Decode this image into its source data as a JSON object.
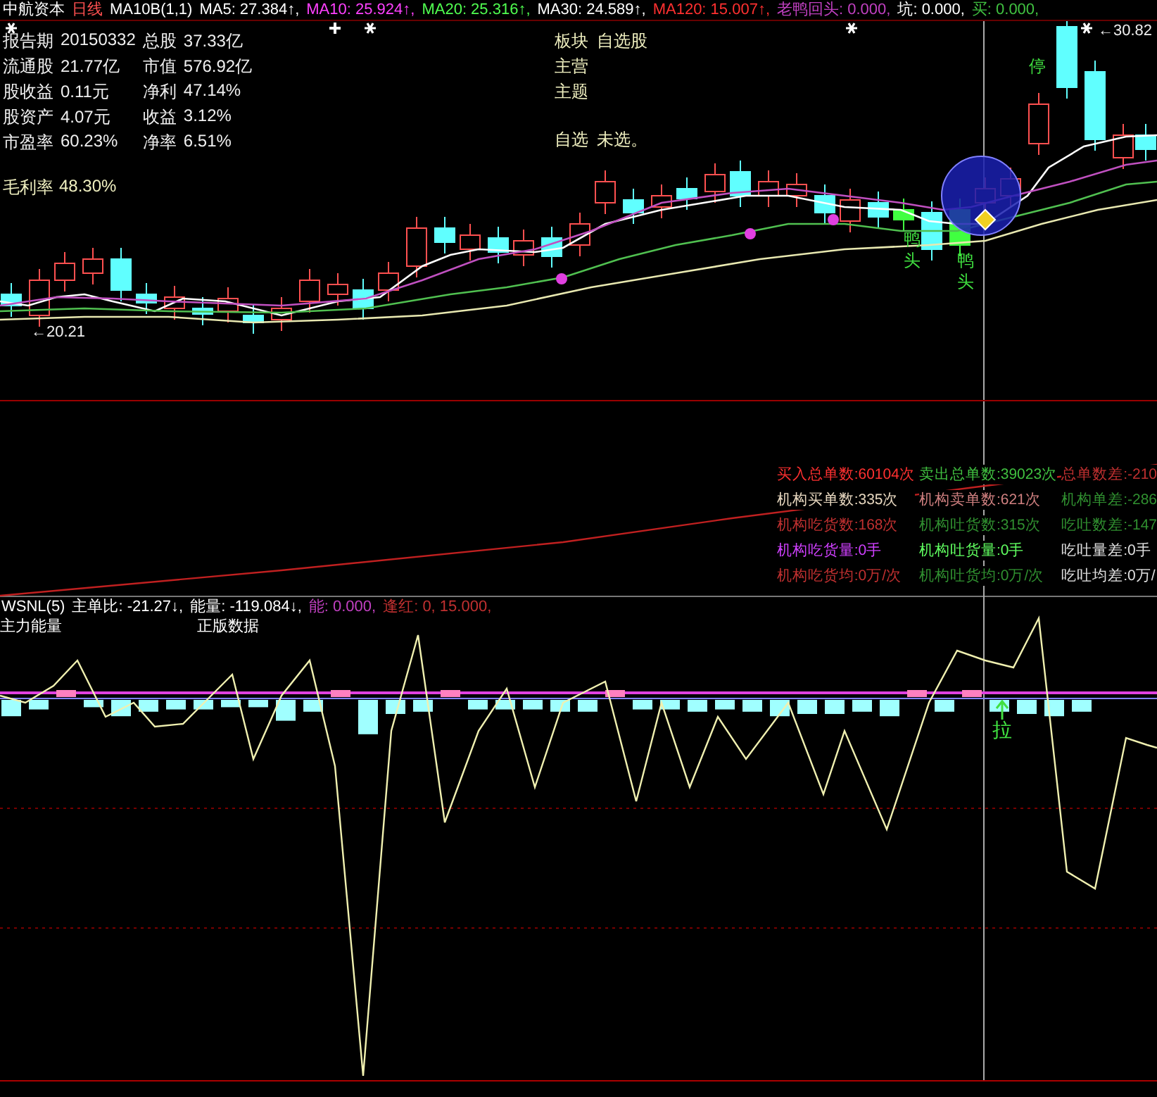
{
  "header": {
    "stock": "中航资本",
    "period": "日线",
    "indicators": [
      {
        "text": "MA10B(1,1)",
        "color": "#ffffff"
      },
      {
        "text": "MA5: 27.384↑,",
        "color": "#ffffff"
      },
      {
        "text": "MA10: 25.924↑,",
        "color": "#ff40ff"
      },
      {
        "text": "MA20: 25.316↑,",
        "color": "#50ff50"
      },
      {
        "text": "MA30: 24.589↑,",
        "color": "#ffffff"
      },
      {
        "text": "MA120: 15.007↑,",
        "color": "#ff3030"
      },
      {
        "text": "老鸭回头: 0.000,",
        "color": "#c040c0"
      },
      {
        "text": "坑: 0.000,",
        "color": "#ffffff"
      },
      {
        "text": "买: 0.000,",
        "color": "#40c040"
      }
    ]
  },
  "fundamentals": {
    "rows": [
      [
        {
          "label": "报告期",
          "value": "20150332"
        },
        {
          "label": "总股",
          "value": "37.33亿"
        }
      ],
      [
        {
          "label": "流通股",
          "value": "21.77亿"
        },
        {
          "label": "市值",
          "value": "576.92亿"
        }
      ],
      [
        {
          "label": "股收益",
          "value": "0.11元"
        },
        {
          "label": "净利",
          "value": "47.14%"
        }
      ],
      [
        {
          "label": "股资产",
          "value": "4.07元"
        },
        {
          "label": "收益",
          "value": "3.12%"
        }
      ],
      [
        {
          "label": "市盈率",
          "value": "60.23%"
        },
        {
          "label": "净率",
          "value": "6.51%"
        }
      ]
    ],
    "extra": {
      "label": "毛利率",
      "value": "48.30%"
    }
  },
  "sector_info": [
    {
      "label": "板块",
      "value": "自选股"
    },
    {
      "label": "主营"
    },
    {
      "label": "主题"
    },
    {
      "label": "自选",
      "value": "未选。"
    }
  ],
  "price_chart": {
    "low_label": "←20.21",
    "high_label": "←30.82",
    "signals": [
      {
        "text": "停"
      },
      {
        "text": "鸭头"
      },
      {
        "text": "鸭头"
      }
    ]
  },
  "order_stats": {
    "rows": [
      [
        {
          "text": "买入总单数:60104次",
          "color": "#ff3030"
        },
        {
          "text": "卖出总单数:39023次",
          "color": "#40c040"
        },
        {
          "text": "总单数差:-210",
          "color": "#c03030"
        }
      ],
      [
        {
          "text": "机构买单数:335次",
          "color": "#e8d8c0"
        },
        {
          "text": "机构卖单数:621次",
          "color": "#d08080"
        },
        {
          "text": "机构单差:-286",
          "color": "#309030"
        }
      ],
      [
        {
          "text": "机构吃货数:168次",
          "color": "#c03030"
        },
        {
          "text": "机构吐货数:315次",
          "color": "#309030"
        },
        {
          "text": "吃吐数差:-147",
          "color": "#309030"
        }
      ],
      [
        {
          "text": "机构吃货量:0手",
          "color": "#d040ff"
        },
        {
          "text": "机构吐货量:0手",
          "color": "#60ff60"
        },
        {
          "text": "吃吐量差:0手",
          "color": "#e0e0e0"
        }
      ],
      [
        {
          "text": "机构吃货均:0万/次",
          "color": "#c03030"
        },
        {
          "text": "机构吐货均:0万/次",
          "color": "#309030"
        },
        {
          "text": "吃吐均差:0万/",
          "color": "#e0e0e0"
        }
      ]
    ]
  },
  "indicator_panel": {
    "title": "WSNL(5)",
    "values": [
      {
        "text": "主单比: -21.27↓,",
        "color": "#ffffff"
      },
      {
        "text": "能量: -119.084↓,",
        "color": "#ffffff"
      },
      {
        "text": "能: 0.000,",
        "color": "#c040c0"
      },
      {
        "text": "逢红: 0, 15.000,",
        "color": "#c03030"
      }
    ],
    "line_label": "主力能量",
    "note": "正版数据",
    "signal": "拉"
  }
}
